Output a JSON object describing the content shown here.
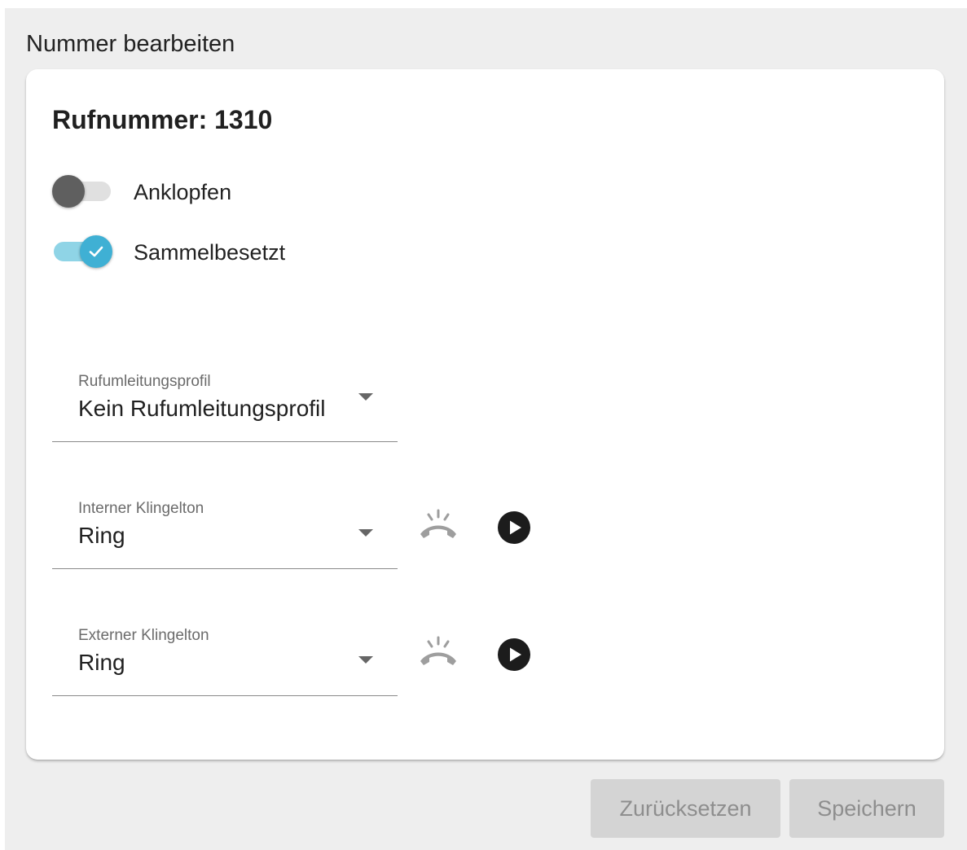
{
  "page": {
    "title": "Nummer bearbeiten"
  },
  "card": {
    "title": "Rufnummer: 1310",
    "toggles": [
      {
        "label": "Anklopfen",
        "checked": false
      },
      {
        "label": "Sammelbesetzt",
        "checked": true
      }
    ],
    "forward_profile": {
      "label": "Rufumleitungsprofil",
      "value": "Kein Rufumleitungsprofil"
    },
    "internal_ringtone": {
      "label": "Interner Klingelton",
      "value": "Ring"
    },
    "external_ringtone": {
      "label": "Externer Klingelton",
      "value": "Ring"
    }
  },
  "icons": {
    "ring": "ringing-phone-icon",
    "play": "play-circle-icon"
  },
  "colors": {
    "accent": "#3fb0d4",
    "accent_track": "#8fd4e6",
    "button_disabled": "#d4d4d4"
  },
  "actions": {
    "reset_label": "Zurücksetzen",
    "save_label": "Speichern"
  }
}
